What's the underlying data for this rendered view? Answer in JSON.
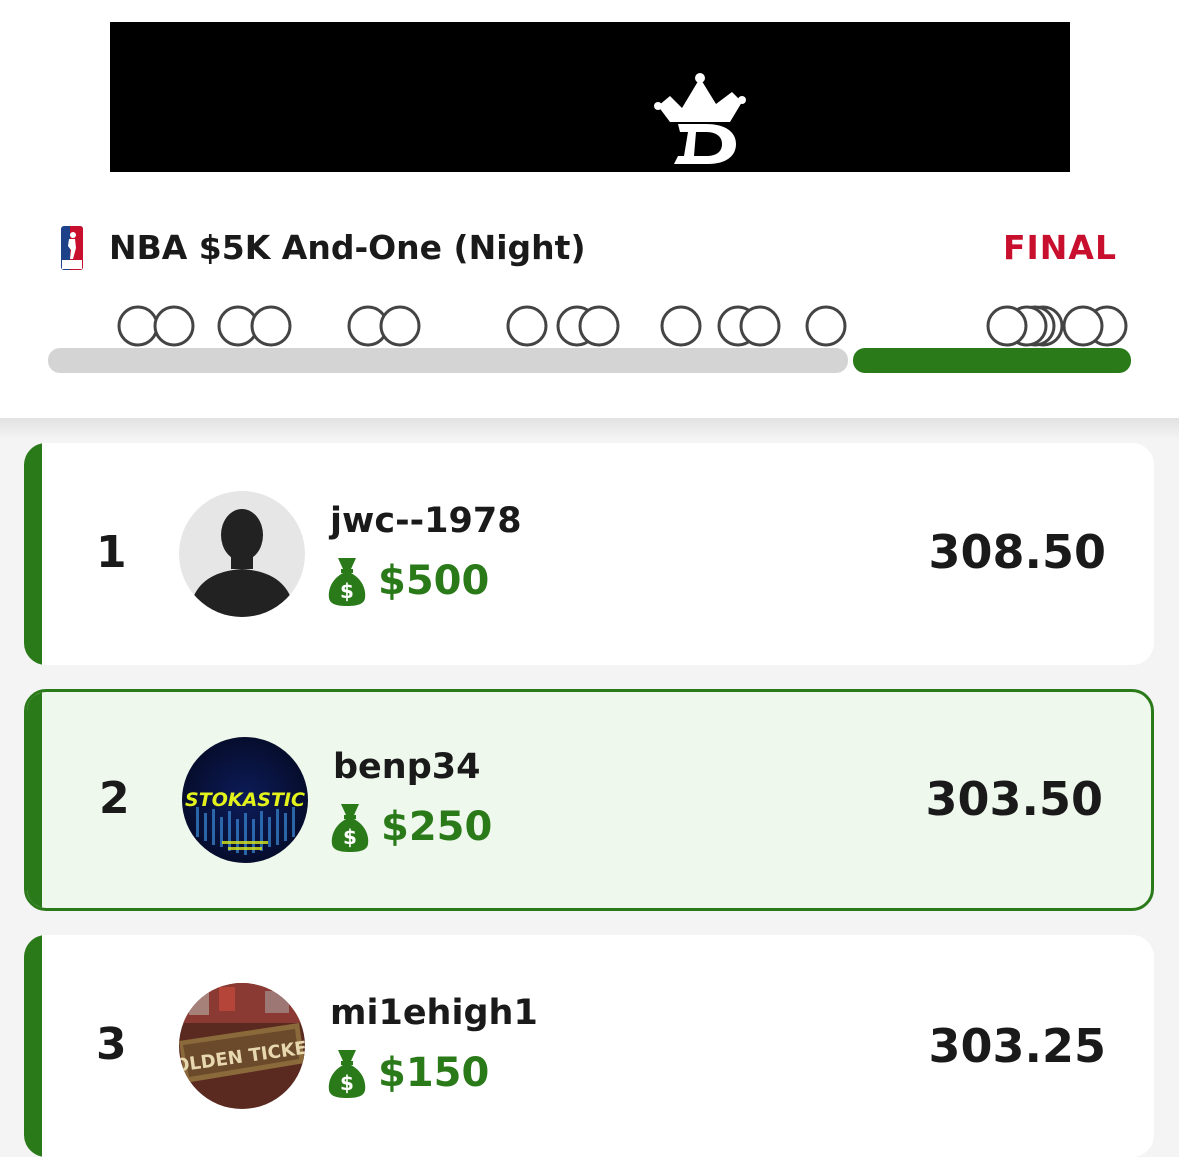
{
  "contest": {
    "title": "NBA $5K And-One (Night)",
    "status": "FINAL",
    "league_icon": "nba-logo-icon",
    "brand_icon": "draftkings-crown-logo-icon"
  },
  "colors": {
    "accent_green": "#2a7a1a",
    "status_red": "#c8102e",
    "highlight_bg": "#eef8ec"
  },
  "leaderboard": [
    {
      "rank": "1",
      "username": "jwc--1978",
      "prize": "$500",
      "score": "308.50",
      "avatar": "default-silhouette-avatar",
      "is_user": false
    },
    {
      "rank": "2",
      "username": "benp34",
      "prize": "$250",
      "score": "303.50",
      "avatar": "stokastic-avatar",
      "avatar_text": "STOKASTIC",
      "is_user": true
    },
    {
      "rank": "3",
      "username": "mi1ehigh1",
      "prize": "$150",
      "score": "303.25",
      "avatar": "golden-ticket-avatar",
      "is_user": false
    }
  ]
}
